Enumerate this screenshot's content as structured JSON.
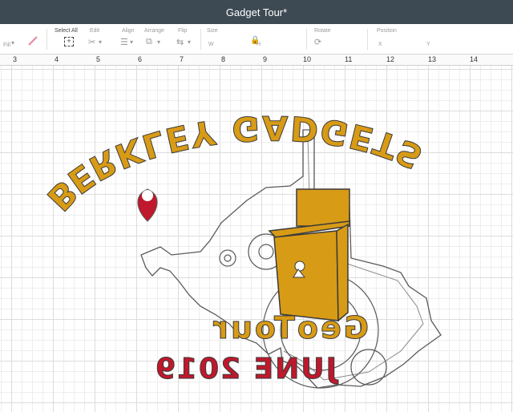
{
  "window": {
    "title": "Gadget Tour*"
  },
  "toolbar": {
    "fill_label": "Fill",
    "select_all_label": "Select All",
    "edit_label": "Edit",
    "align_label": "Align",
    "arrange_label": "Arrange",
    "flip_label": "Flip",
    "size_label": "Size",
    "size_w_label": "W",
    "size_h_label": "H",
    "rotate_label": "Rotate",
    "position_label": "Position",
    "position_x_label": "X",
    "position_y_label": "Y"
  },
  "ruler": {
    "ticks": [
      "3",
      "4",
      "5",
      "6",
      "7",
      "8",
      "9",
      "10",
      "11",
      "12",
      "13",
      "14"
    ]
  },
  "design": {
    "arc_text": "BERKLEY GADGETS",
    "line1": "GeoTour",
    "line2": "JUNE 2019",
    "colors": {
      "gold": "#d89b16",
      "red": "#c0182c",
      "outline": "#5a5a5a"
    }
  }
}
